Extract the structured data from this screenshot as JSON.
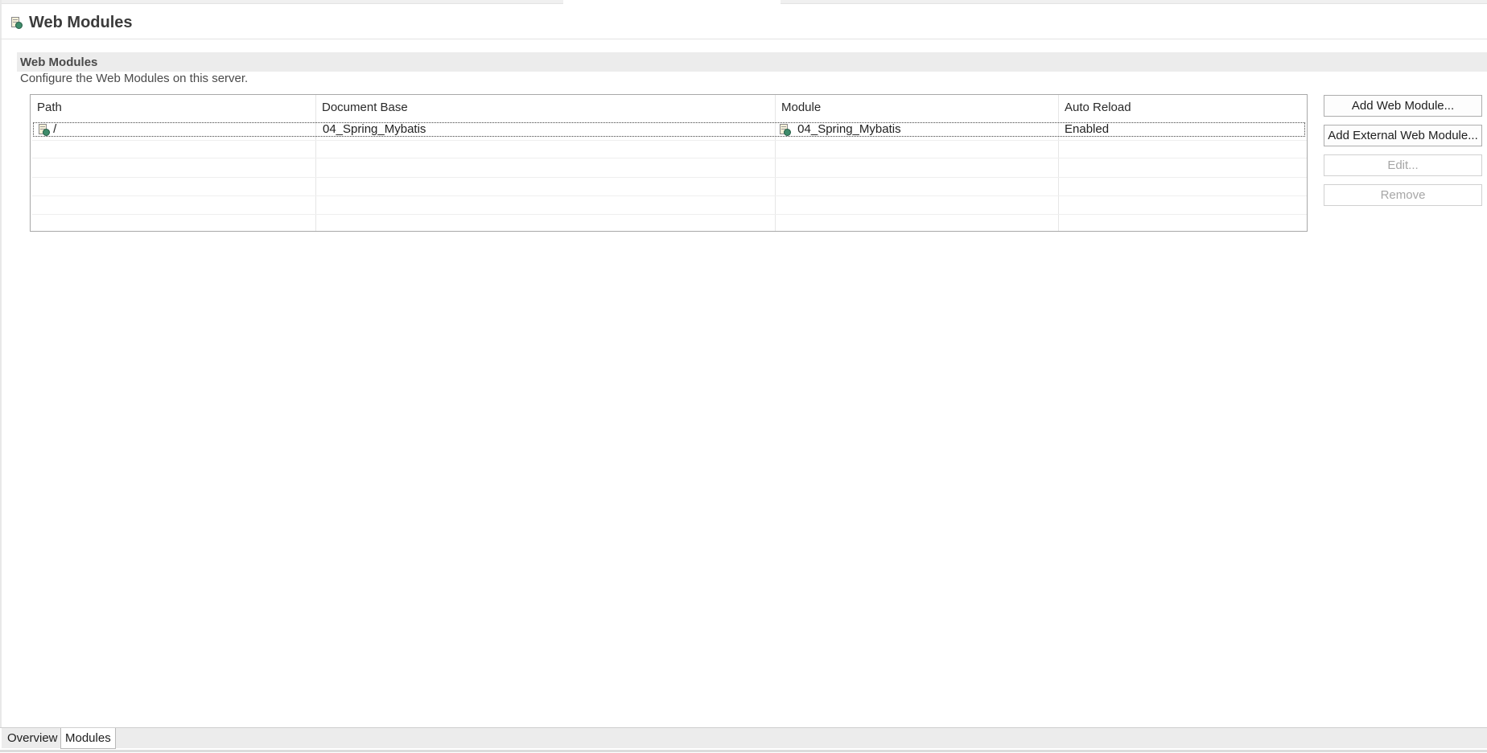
{
  "editor": {
    "title": "Web Modules"
  },
  "section": {
    "title": "Web Modules",
    "description": "Configure the Web Modules on this server."
  },
  "table": {
    "columns": [
      "Path",
      "Document Base",
      "Module",
      "Auto Reload"
    ],
    "rows": [
      {
        "path": "/",
        "document_base": "04_Spring_Mybatis",
        "module": "04_Spring_Mybatis",
        "auto_reload": "Enabled"
      }
    ]
  },
  "buttons": {
    "add_web_module": "Add Web Module...",
    "add_external_web_module": "Add External Web Module...",
    "edit": "Edit...",
    "remove": "Remove"
  },
  "bottom_tabs": {
    "overview": "Overview",
    "modules": "Modules",
    "active": "Modules"
  },
  "icons": {
    "header": "web-module-icon",
    "row_path": "web-module-icon",
    "row_module": "web-module-icon"
  }
}
